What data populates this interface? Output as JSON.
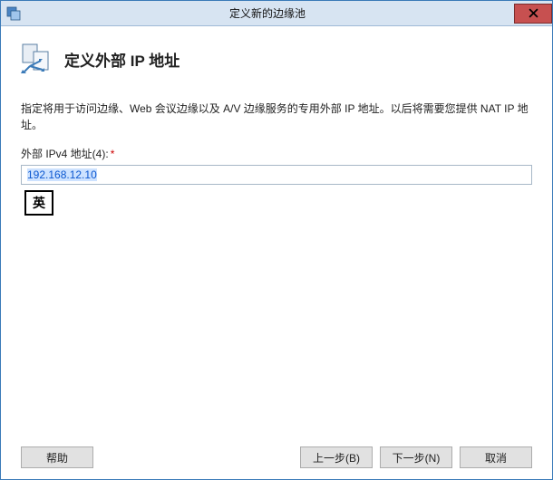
{
  "titlebar": {
    "title": "定义新的边缘池"
  },
  "page": {
    "title": "定义外部 IP 地址",
    "description": "指定将用于访问边缘、Web 会议边缘以及 A/V 边缘服务的专用外部 IP 地址。以后将需要您提供 NAT IP 地址。"
  },
  "field": {
    "label": "外部 IPv4 地址(4):",
    "required": "*",
    "value": "192.168.12.10"
  },
  "ime": {
    "indicator": "英"
  },
  "buttons": {
    "help": "帮助",
    "back": "上一步(B)",
    "next": "下一步(N)",
    "cancel": "取消"
  }
}
